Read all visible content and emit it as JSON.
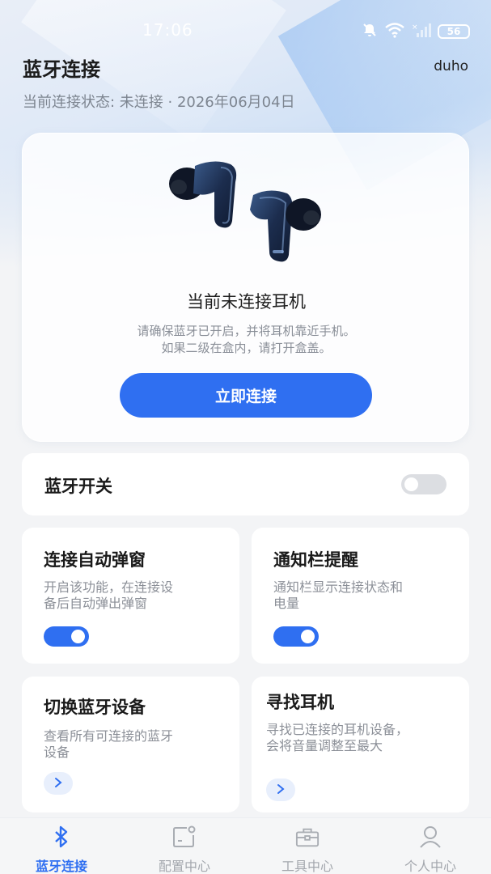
{
  "status_bar": {
    "time": "17:06",
    "battery": "56",
    "icons": [
      "mute-icon",
      "wifi-icon",
      "signal-icon",
      "battery-icon"
    ]
  },
  "header": {
    "title": "蓝牙连接",
    "user": "duho",
    "status_text": "当前连接状态:  未连接 · 2026年06月04日"
  },
  "hero": {
    "title": "当前未连接耳机",
    "desc_line1": "请确保蓝牙已开启，并将耳机靠近手机。",
    "desc_line2": "如果二级在盒内，请打开盒盖。",
    "button_label": "立即连接"
  },
  "bluetooth_switch": {
    "label": "蓝牙开关",
    "on": false
  },
  "cards": {
    "auto_popup": {
      "title": "连接自动弹窗",
      "desc_line1": "开启该功能，在连接设",
      "desc_line2": "备后自动弹出弹窗",
      "on": true
    },
    "notify": {
      "title": "通知栏提醒",
      "desc_line1": "通知栏显示连接状态和",
      "desc_line2": "电量",
      "on": true
    },
    "switch_device": {
      "title": "切换蓝牙设备",
      "desc_line1": "查看所有可连接的蓝牙",
      "desc_line2": "设备"
    },
    "find_earbuds": {
      "title": "寻找耳机",
      "desc_line1": "寻找已连接的耳机设备，",
      "desc_line2": "会将音量调整至最大"
    }
  },
  "nav": {
    "items": [
      {
        "label": "蓝牙连接",
        "icon": "bluetooth-icon",
        "active": true
      },
      {
        "label": "配置中心",
        "icon": "config-icon",
        "active": false
      },
      {
        "label": "工具中心",
        "icon": "toolbox-icon",
        "active": false
      },
      {
        "label": "个人中心",
        "icon": "person-icon",
        "active": false
      }
    ]
  },
  "colors": {
    "accent": "#2f6ff1",
    "background": "#f3f4f6",
    "muted_text": "#8c9098"
  }
}
